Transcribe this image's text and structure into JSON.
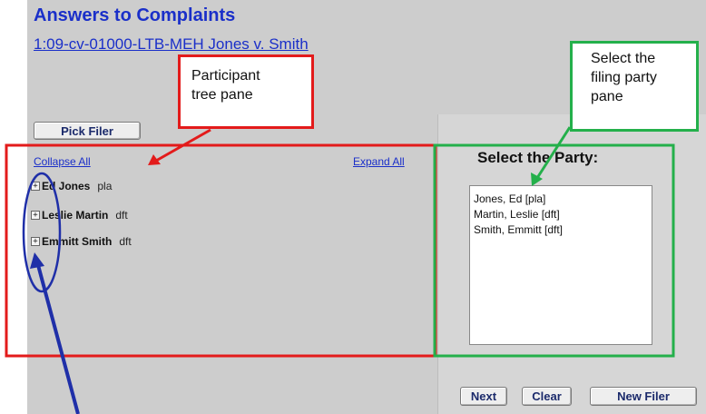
{
  "header": {
    "title": "Answers to Complaints",
    "case_link": "1:09-cv-01000-LTB-MEH Jones v. Smith"
  },
  "toolbar": {
    "pick_filer_label": "Pick Filer"
  },
  "tree": {
    "collapse_all": "Collapse All",
    "expand_all": "Expand All",
    "nodes": [
      {
        "name": "Ed Jones",
        "role": "pla"
      },
      {
        "name": "Leslie Martin",
        "role": "dft"
      },
      {
        "name": "Emmitt Smith",
        "role": "dft"
      }
    ]
  },
  "party_pane": {
    "heading": "Select the Party:",
    "options": [
      "Jones, Ed  [pla]",
      "Martin, Leslie  [dft]",
      "Smith, Emmitt  [dft]"
    ]
  },
  "buttons": {
    "next": "Next",
    "clear": "Clear",
    "new_filer": "New Filer"
  },
  "annotations": {
    "participant_tree": [
      "Participant",
      "tree pane"
    ],
    "filing_party": [
      "Select the",
      "filing party",
      "pane"
    ]
  },
  "colors": {
    "red_callout": "#e31b1b",
    "green_callout": "#24b04b",
    "blue_marker": "#1f2fa8",
    "link": "#1a2fc9"
  }
}
